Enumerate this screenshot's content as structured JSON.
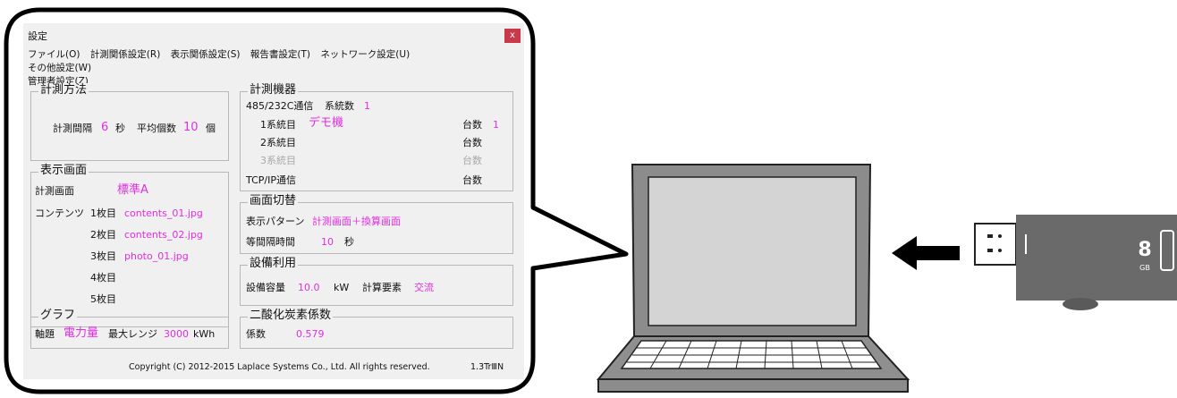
{
  "window": {
    "title": "設定",
    "close_label": "x"
  },
  "menu": [
    "ファイル(O)",
    "計測関係設定(R)",
    "表示関係設定(S)",
    "報告書設定(T)",
    "ネットワーク設定(U)",
    "その他設定(W)",
    "管理者設定(Z)"
  ],
  "measure_method": {
    "title": "計測方法",
    "interval_label": "計測間隔",
    "interval_value": "6",
    "interval_unit": "秒",
    "avg_label": "平均個数",
    "avg_value": "10",
    "avg_unit": "個"
  },
  "instrument": {
    "title": "計測機器",
    "comm_label": "485/232C通信",
    "systems_label": "系統数",
    "systems_value": "1",
    "rows": [
      {
        "name": "1系統目",
        "device": "デモ機",
        "count_label": "台数",
        "count": "1"
      },
      {
        "name": "2系統目",
        "device": "",
        "count_label": "台数",
        "count": ""
      },
      {
        "name": "3系統目",
        "device": "",
        "count_label": "台数",
        "count": ""
      }
    ],
    "tcp_label": "TCP/IP通信",
    "tcp_count_label": "台数"
  },
  "display": {
    "title": "表示画面",
    "screen_label": "計測画面",
    "screen_value": "標準A",
    "contents_label": "コンテンツ",
    "items": [
      {
        "n": "1枚目",
        "file": "contents_01.jpg"
      },
      {
        "n": "2枚目",
        "file": "contents_02.jpg"
      },
      {
        "n": "3枚目",
        "file": "photo_01.jpg"
      },
      {
        "n": "4枚目",
        "file": ""
      },
      {
        "n": "5枚目",
        "file": ""
      }
    ]
  },
  "switch": {
    "title": "画面切替",
    "pattern_label": "表示パターン",
    "pattern_value": "計測画面＋換算画面",
    "interval_label": "等間隔時間",
    "interval_value": "10",
    "interval_unit": "秒"
  },
  "equipment": {
    "title": "設備利用",
    "capacity_label": "設備容量",
    "capacity_value": "10.0",
    "capacity_unit": "kW",
    "calc_label": "計算要素",
    "calc_value": "交流"
  },
  "graph": {
    "title": "グラフ",
    "axis_label": "軸題",
    "axis_value": "電力量",
    "range_label": "最大レンジ",
    "range_value": "3000",
    "range_unit": "kWh"
  },
  "co2": {
    "title": "二酸化炭素係数",
    "coef_label": "係数",
    "coef_value": "0.579"
  },
  "footer": {
    "copyright": "Copyright (C) 2012-2015 Laplace Systems Co., Ltd. All rights reserved.",
    "version": "1.3TrⅢN"
  },
  "usb": {
    "capacity": "8",
    "unit": "GB"
  },
  "colors": {
    "accent": "#e02ee0",
    "close": "#c9394a",
    "laptop": "#8c8c8c",
    "usb": "#6a6a6a"
  }
}
